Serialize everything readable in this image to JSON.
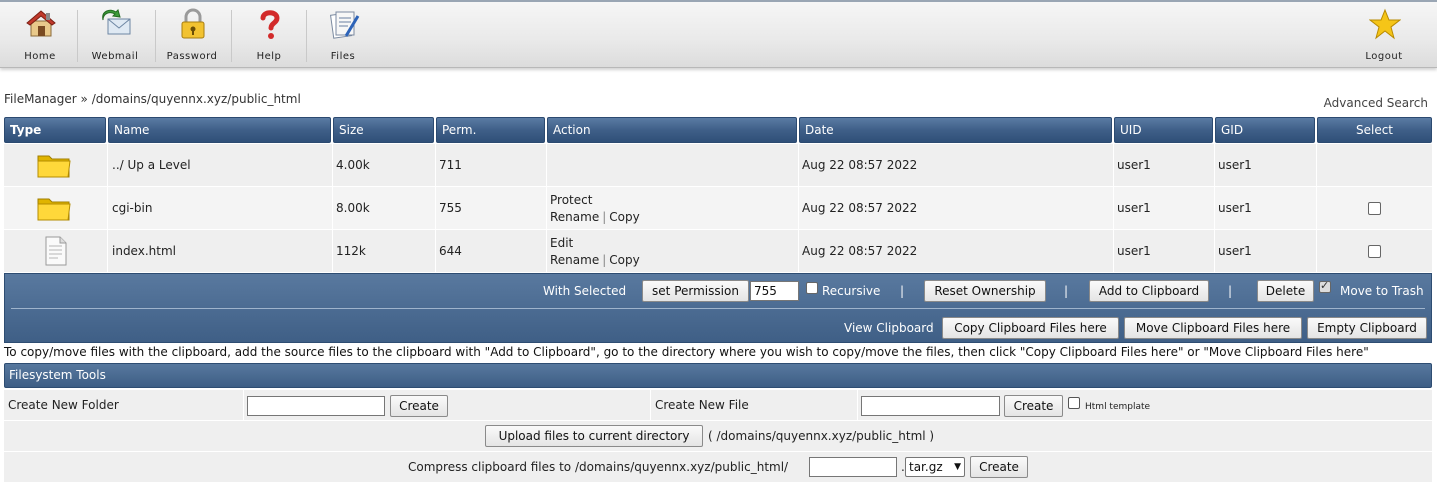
{
  "toolbar": {
    "items": [
      {
        "label": "Home",
        "icon": "home-icon"
      },
      {
        "label": "Webmail",
        "icon": "webmail-icon"
      },
      {
        "label": "Password",
        "icon": "lock-icon"
      },
      {
        "label": "Help",
        "icon": "help-icon"
      },
      {
        "label": "Files",
        "icon": "files-icon"
      }
    ],
    "logout": {
      "label": "Logout",
      "icon": "star-icon"
    }
  },
  "breadcrumb": {
    "root": "FileManager",
    "separator": "»",
    "path": "/domains/quyennx.xyz/public_html"
  },
  "advanced_search": "Advanced Search",
  "table": {
    "headers": [
      "Type",
      "Name",
      "Size",
      "Perm.",
      "Action",
      "Date",
      "UID",
      "GID",
      "Select"
    ],
    "rows": [
      {
        "type_icon": "folder-icon",
        "name": "../ Up a Level",
        "size": "4.00k",
        "perm": "711",
        "action_line1": "",
        "action_line2a": "",
        "action_line2b": "",
        "date": "Aug 22 08:57 2022",
        "uid": "user1",
        "gid": "user1",
        "selectable": false
      },
      {
        "type_icon": "folder-icon",
        "name": "cgi-bin",
        "size": "8.00k",
        "perm": "755",
        "action_line1": "Protect",
        "action_line2a": "Rename",
        "action_line2b": "Copy",
        "date": "Aug 22 08:57 2022",
        "uid": "user1",
        "gid": "user1",
        "selectable": true
      },
      {
        "type_icon": "file-icon",
        "name": "index.html",
        "size": "112k",
        "perm": "644",
        "action_line1": "Edit",
        "action_line2a": "Rename",
        "action_line2b": "Copy",
        "date": "Aug 22 08:57 2022",
        "uid": "user1",
        "gid": "user1",
        "selectable": true
      }
    ],
    "action_separator": "|"
  },
  "bulk": {
    "with_selected": "With Selected",
    "set_permission": "set Permission",
    "permission_value": "755",
    "recursive": "Recursive",
    "pipe": "|",
    "reset_ownership": "Reset Ownership",
    "add_to_clipboard": "Add to Clipboard",
    "delete": "Delete",
    "move_to_trash": "Move to Trash",
    "move_to_trash_checked": true,
    "view_clipboard": "View Clipboard",
    "copy_here": "Copy Clipboard Files here",
    "move_here": "Move Clipboard Files here",
    "empty_clipboard": "Empty Clipboard"
  },
  "clipboard_help": "To copy/move files with the clipboard, add the source files to the clipboard with \"Add to Clipboard\", go to the directory where you wish to copy/move the files, then click \"Copy Clipboard Files here\" or \"Move Clipboard Files here\"",
  "fs_tools": {
    "title": "Filesystem Tools",
    "create_folder_label": "Create New Folder",
    "create_label": "Create",
    "create_file_label": "Create New File",
    "html_template": "Html template",
    "upload_button": "Upload files to current directory",
    "upload_path": "( /domains/quyennx.xyz/public_html )",
    "compress_label": "Compress clipboard files to /domains/quyennx.xyz/public_html/",
    "compress_dot": ".",
    "compress_format": "tar.gz"
  }
}
